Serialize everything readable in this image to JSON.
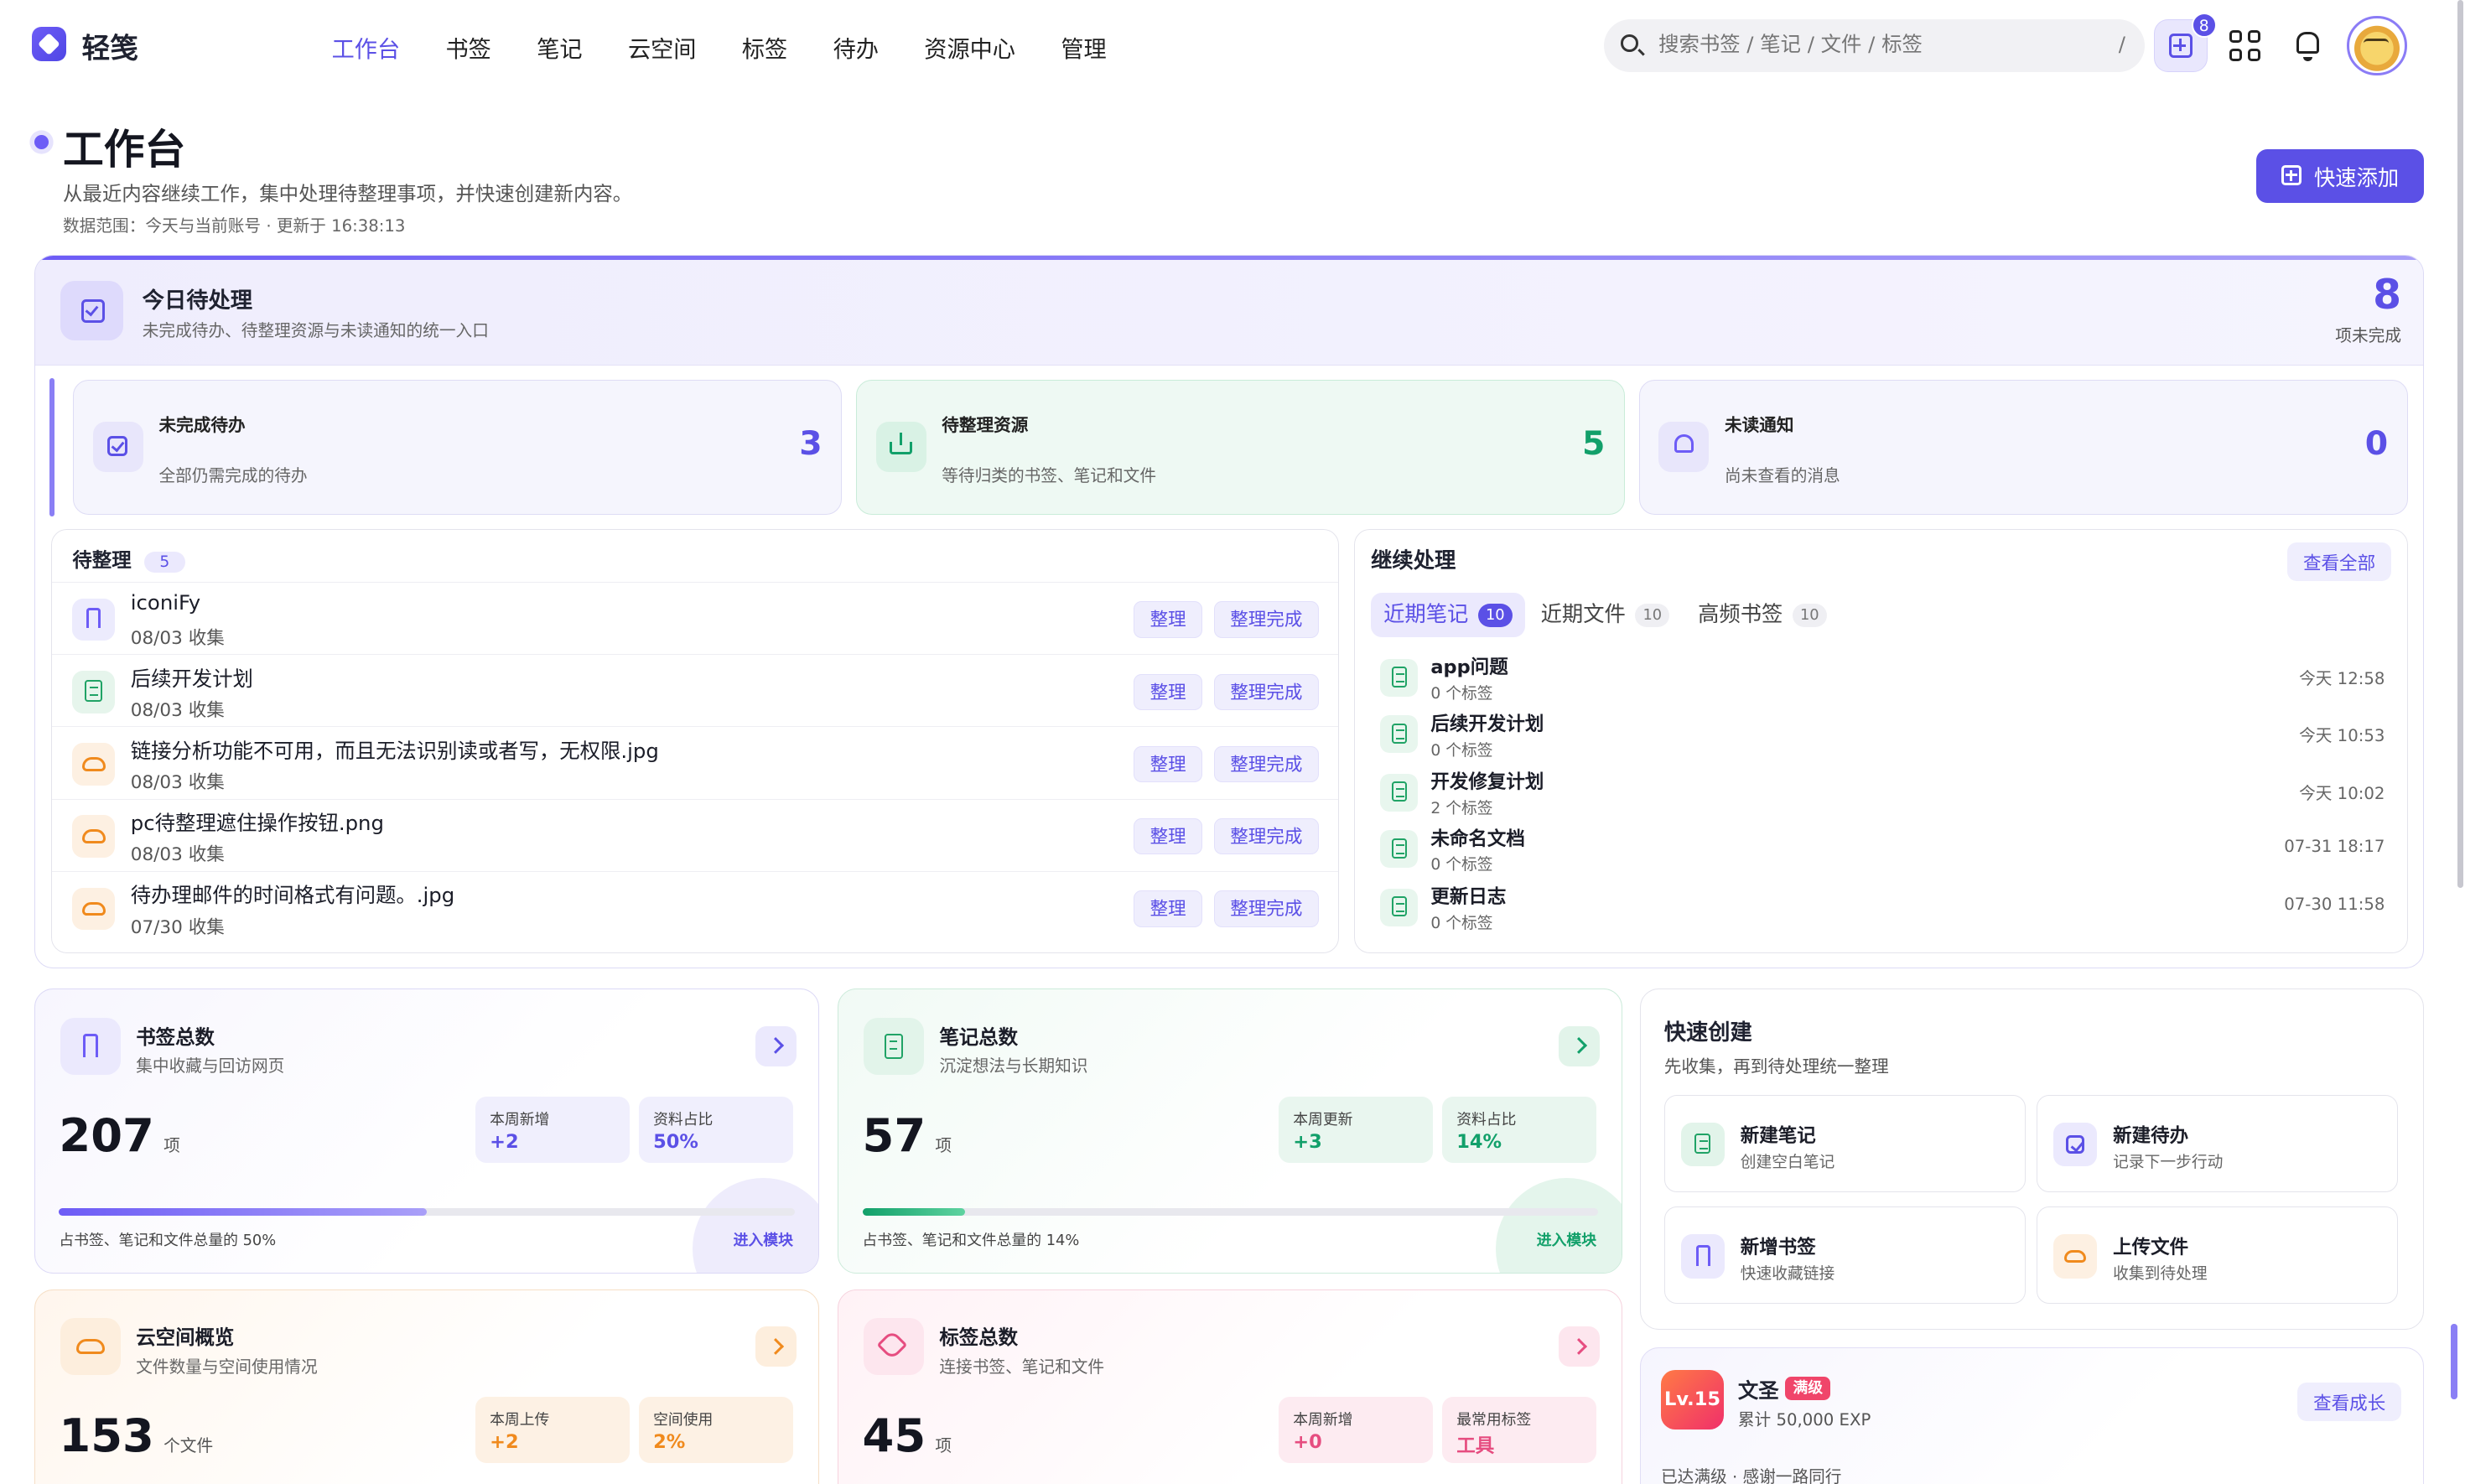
{
  "app": {
    "name": "轻笺"
  },
  "nav": [
    "工作台",
    "书签",
    "笔记",
    "云空间",
    "标签",
    "待办",
    "资源中心",
    "管理"
  ],
  "nav_active": "工作台",
  "search": {
    "placeholder": "搜索书签 / 笔记 / 文件 / 标签",
    "shortcut": "/"
  },
  "top": {
    "add_badge": "8"
  },
  "header": {
    "title": "工作台",
    "subtitle": "从最近内容继续工作，集中处理待整理事项，并快速创建新内容。",
    "meta": "数据范围：今天与当前账号 · 更新于 16:38:13",
    "quick_add": "快速添加"
  },
  "today": {
    "title": "今日待处理",
    "subtitle": "未完成待办、待整理资源与未读通知的统一入口",
    "count": "8",
    "count_label": "项未完成",
    "stats": [
      {
        "title": "未完成待办",
        "desc": "全部仍需完成的待办",
        "value": "3",
        "icon": "check-square-icon",
        "color": "#5b50e6"
      },
      {
        "title": "待整理资源",
        "desc": "等待归类的书签、笔记和文件",
        "value": "5",
        "icon": "inbox-icon",
        "color": "#12a06a"
      },
      {
        "title": "未读通知",
        "desc": "尚未查看的消息",
        "value": "0",
        "icon": "bell-icon",
        "color": "#5b50e6"
      }
    ]
  },
  "pending": {
    "title": "待整理",
    "count": "5",
    "organize": "整理",
    "done": "整理完成",
    "items": [
      {
        "name": "iconiFy",
        "date": "08/03 收集",
        "icon": "bookmark-icon"
      },
      {
        "name": "后续开发计划",
        "date": "08/03 收集",
        "icon": "note-icon"
      },
      {
        "name": "链接分析功能不可用，而且无法识别读或者写，无权限.jpg",
        "date": "08/03 收集",
        "icon": "cloud-icon"
      },
      {
        "name": "pc待整理遮住操作按钮.png",
        "date": "08/03 收集",
        "icon": "cloud-icon"
      },
      {
        "name": "待办理邮件的时间格式有问题。.jpg",
        "date": "07/30 收集",
        "icon": "cloud-icon"
      }
    ]
  },
  "continue": {
    "title": "继续处理",
    "view_all": "查看全部",
    "tabs": [
      {
        "label": "近期笔记",
        "count": "10"
      },
      {
        "label": "近期文件",
        "count": "10"
      },
      {
        "label": "高频书签",
        "count": "10"
      }
    ],
    "items": [
      {
        "name": "app问题",
        "tags": "0 个标签",
        "time": "今天 12:58"
      },
      {
        "name": "后续开发计划",
        "tags": "0 个标签",
        "time": "今天 10:53"
      },
      {
        "name": "开发修复计划",
        "tags": "2 个标签",
        "time": "今天 10:02"
      },
      {
        "name": "未命名文档",
        "tags": "0 个标签",
        "time": "07-31 18:17"
      },
      {
        "name": "更新日志",
        "tags": "0 个标签",
        "time": "07-30 11:58"
      }
    ]
  },
  "cards": {
    "bookmarks": {
      "title": "书签总数",
      "desc": "集中收藏与回访网页",
      "value": "207",
      "unit": "项",
      "m1_label": "本周新增",
      "m1_value": "+2",
      "m2_label": "资料占比",
      "m2_value": "50%",
      "progress": 0.5,
      "foot": "占书签、笔记和文件总量的 50%",
      "enter": "进入模块"
    },
    "notes": {
      "title": "笔记总数",
      "desc": "沉淀想法与长期知识",
      "value": "57",
      "unit": "项",
      "m1_label": "本周更新",
      "m1_value": "+3",
      "m2_label": "资料占比",
      "m2_value": "14%",
      "progress": 0.14,
      "foot": "占书签、笔记和文件总量的 14%",
      "enter": "进入模块"
    },
    "cloud": {
      "title": "云空间概览",
      "desc": "文件数量与空间使用情况",
      "value": "153",
      "unit": "个文件",
      "m1_label": "本周上传",
      "m1_value": "+2",
      "m2_label": "空间使用",
      "m2_value": "2%"
    },
    "tags": {
      "title": "标签总数",
      "desc": "连接书签、笔记和文件",
      "value": "45",
      "unit": "项",
      "m1_label": "本周新增",
      "m1_value": "+0",
      "m2_label": "最常用标签",
      "m2_value": "工具"
    }
  },
  "quick_create": {
    "title": "快速创建",
    "desc": "先收集，再到待处理统一整理",
    "items": [
      {
        "title": "新建笔记",
        "desc": "创建空白笔记"
      },
      {
        "title": "新建待办",
        "desc": "记录下一步行动"
      },
      {
        "title": "新增书签",
        "desc": "快速收藏链接"
      },
      {
        "title": "上传文件",
        "desc": "收集到待处理"
      }
    ]
  },
  "level": {
    "badge": "Lv.15",
    "name": "文圣",
    "tag": "满级",
    "exp": "累计 50,000 EXP",
    "action": "查看成长",
    "note": "已达满级 · 感谢一路同行"
  }
}
